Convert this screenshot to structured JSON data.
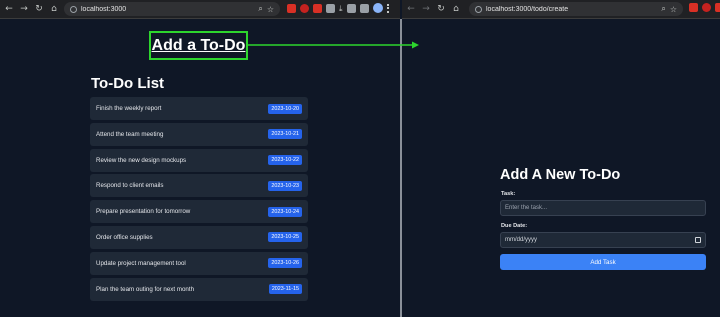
{
  "left_browser": {
    "url": "localhost:3000",
    "nav_icons": [
      "back-icon",
      "forward-icon",
      "reload-icon",
      "home-icon"
    ]
  },
  "right_browser": {
    "url": "localhost:3000/todo/create",
    "nav_icons": [
      "back-icon",
      "forward-icon",
      "reload-icon",
      "home-icon"
    ]
  },
  "callout": {
    "label": "Add a To-Do",
    "color": "#2dd52d"
  },
  "todo_list": {
    "title": "To-Do List",
    "items": [
      {
        "task": "Finish the weekly report",
        "date": "2023-10-20"
      },
      {
        "task": "Attend the team meeting",
        "date": "2023-10-21"
      },
      {
        "task": "Review the new design mockups",
        "date": "2023-10-22"
      },
      {
        "task": "Respond to client emails",
        "date": "2023-10-23"
      },
      {
        "task": "Prepare presentation for tomorrow",
        "date": "2023-10-24"
      },
      {
        "task": "Order office supplies",
        "date": "2023-10-25"
      },
      {
        "task": "Update project management tool",
        "date": "2023-10-26"
      },
      {
        "task": "Plan the team outing for next month",
        "date": "2023-11-15"
      }
    ]
  },
  "form": {
    "title": "Add A New To-Do",
    "task_label": "Task:",
    "task_placeholder": "Enter the task...",
    "due_label": "Due Date:",
    "due_value": "mm/dd/yyyy",
    "submit_label": "Add Task"
  },
  "colors": {
    "background": "#0f1726",
    "card": "#1f2937",
    "date_badge": "#2563eb",
    "button": "#3b82f6"
  }
}
